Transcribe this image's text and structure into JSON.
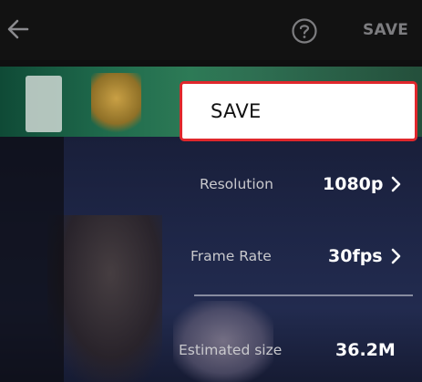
{
  "header": {
    "back_icon": "arrow-left-icon",
    "help_icon": "question-circle-icon",
    "save_label": "SAVE"
  },
  "save_dialog": {
    "button_label": "SAVE",
    "highlight_color": "#e0272c"
  },
  "settings": [
    {
      "label": "Resolution",
      "value": "1080p",
      "icon": "chevron-right-icon"
    },
    {
      "label": "Frame Rate",
      "value": "30fps",
      "icon": "chevron-right-icon"
    },
    {
      "label": "Estimated size",
      "value": "36.2M"
    }
  ],
  "colors": {
    "background": "#0f0f10",
    "label_text": "#c9c9cd",
    "value_text": "#ffffff",
    "muted_header": "#7d7d80"
  }
}
